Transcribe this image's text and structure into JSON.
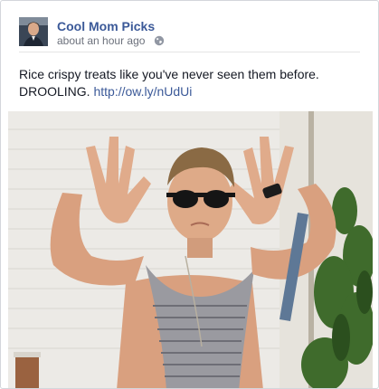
{
  "post": {
    "author": "Cool Mom Picks",
    "timestamp": "about an hour ago",
    "privacy_icon": "globe-icon",
    "text": "Rice crispy treats like you've never seen them before. DROOLING.",
    "link": "http://ow.ly/nUdUi"
  },
  "colors": {
    "link": "#3b5998",
    "meta": "#6b707b",
    "text": "#141823"
  }
}
